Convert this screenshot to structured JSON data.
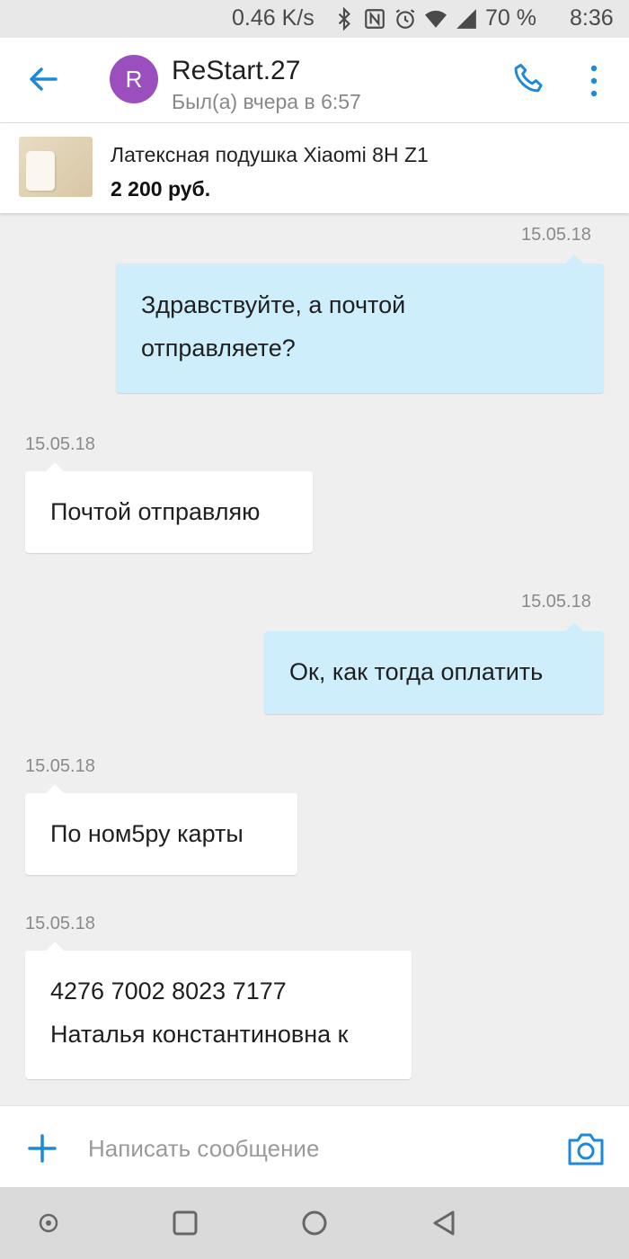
{
  "status_bar": {
    "speed": "0.46 K/s",
    "battery": "70 %",
    "time": "8:36",
    "icons": [
      "bluetooth-icon",
      "nfc-icon",
      "alarm-icon",
      "wifi-icon",
      "signal-icon"
    ]
  },
  "header": {
    "avatar_letter": "R",
    "avatar_color": "#9b4fbe",
    "contact_name": "ReStart.27",
    "contact_status": "Был(а) вчера в 6:57",
    "accent_color": "#1e88d9"
  },
  "product": {
    "title": "Латексная подушка Xiaomi 8H Z1",
    "price": "2 200 руб."
  },
  "messages": [
    {
      "direction": "out",
      "date": "15.05.18",
      "lines": [
        "Здравствуйте, а почтой",
        "отправляете?"
      ]
    },
    {
      "direction": "in",
      "date": "15.05.18",
      "lines": [
        "Почтой отправляю"
      ]
    },
    {
      "direction": "out",
      "date": "15.05.18",
      "lines": [
        "Ок, как тогда оплатить"
      ]
    },
    {
      "direction": "in",
      "date": "15.05.18",
      "lines": [
        "По ном5ру карты"
      ]
    },
    {
      "direction": "in",
      "date": "15.05.18",
      "lines": [
        "4276 7002 8023 7177",
        "Наталья константиновна к"
      ]
    }
  ],
  "composer": {
    "placeholder": "Написать сообщение"
  },
  "colors": {
    "outgoing_bubble": "#cfeefc",
    "incoming_bubble": "#ffffff",
    "background": "#efefef"
  }
}
